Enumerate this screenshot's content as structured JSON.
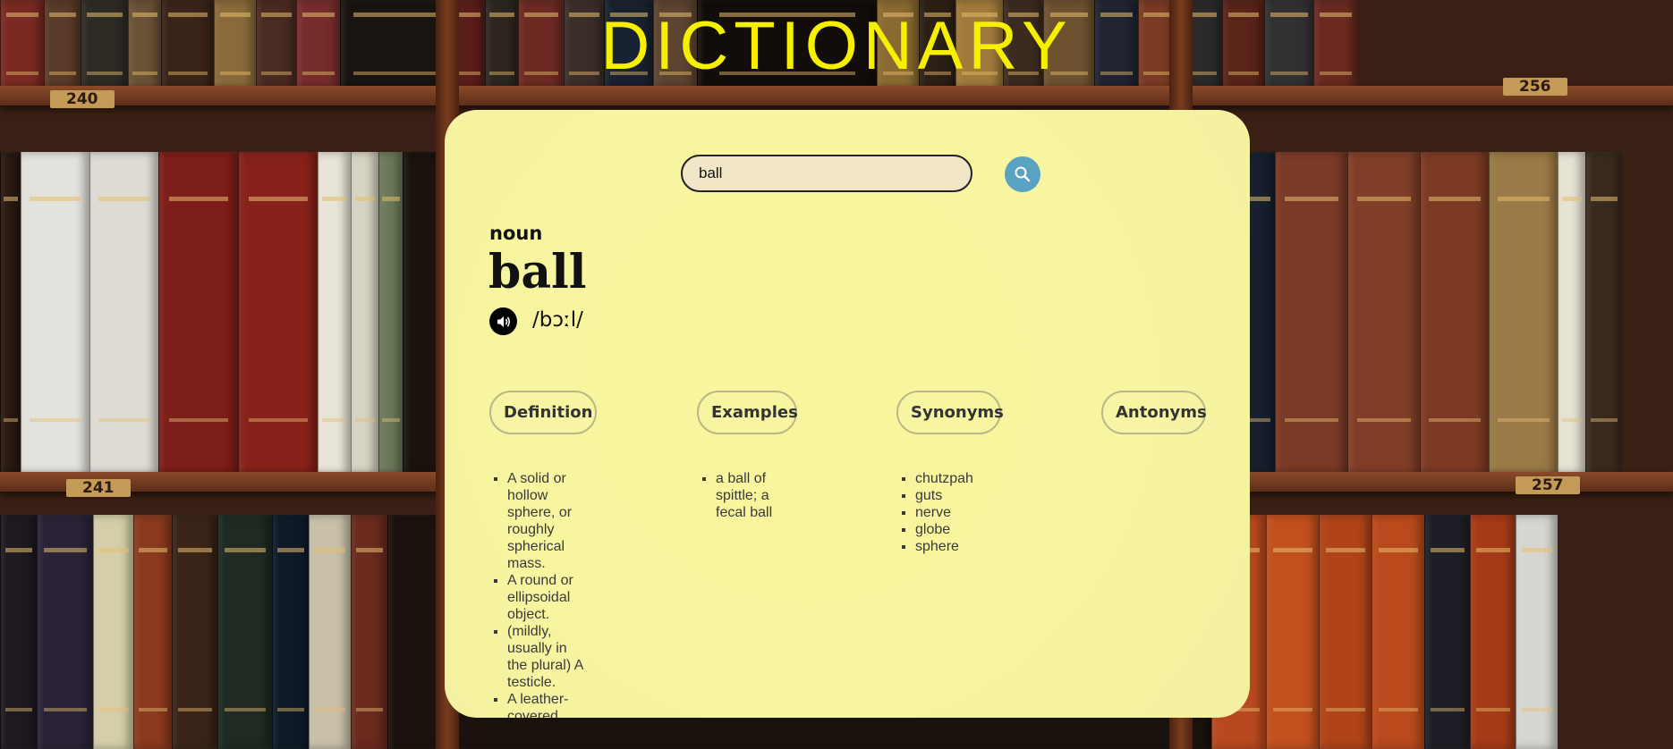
{
  "app": {
    "title": "DICTIONARY"
  },
  "search": {
    "value": "ball",
    "placeholder": ""
  },
  "entry": {
    "part_of_speech": "noun",
    "word": "ball",
    "phonetic": "/bɔːl/"
  },
  "tabs": [
    {
      "label": "Definition"
    },
    {
      "label": "Examples"
    },
    {
      "label": "Synonyms"
    },
    {
      "label": "Antonyms"
    }
  ],
  "definitions": [
    "A solid or hollow sphere, or roughly spherical mass.",
    "A round or ellipsoidal object.",
    "(mildly, usually in the plural) A testicle.",
    "A leather-covered"
  ],
  "examples": [
    "a ball of spittle; a fecal ball"
  ],
  "synonyms": [
    "chutzpah",
    "guts",
    "nerve",
    "globe",
    "sphere"
  ],
  "antonyms": [],
  "background": {
    "shelf_labels": [
      "240",
      "256",
      "241",
      "257"
    ]
  },
  "colors": {
    "title": "#f4f000",
    "card": "#f8f59c",
    "search_button": "#5aa2c2",
    "search_field": "#f1e7c8"
  }
}
